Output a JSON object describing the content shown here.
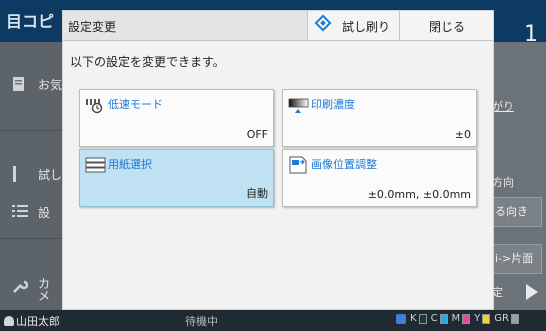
{
  "background": {
    "app_title": "目コピ",
    "counter": "1",
    "left_items": [
      {
        "icon": "document-icon",
        "label": "お気"
      },
      {
        "icon": "thin-bar-icon",
        "label": "試し"
      },
      {
        "icon": "list-icon",
        "label": "設"
      },
      {
        "icon": "wrench-icon",
        "label": "カ\nメ"
      }
    ],
    "right_items": [
      "がり",
      "方向",
      "る向き",
      "i->片面",
      "定"
    ],
    "status": {
      "user": "山田太郎",
      "state": "待機中",
      "inks": [
        "K",
        "C",
        "M",
        "Y",
        "GR"
      ]
    },
    "colors": {
      "ink_c": "#2ea8e0",
      "ink_m": "#e64aa0",
      "ink_y": "#f2d23a",
      "ink_gr": "#9aa0a4"
    }
  },
  "dialog": {
    "title": "設定変更",
    "trial_print_label": "試し刷り",
    "close_label": "閉じる",
    "description": "以下の設定を変更できます。",
    "tiles": [
      {
        "label": "低速モード",
        "value": "OFF",
        "icon": "slow-mode-icon",
        "selected": false
      },
      {
        "label": "印刷濃度",
        "value": "±0",
        "icon": "print-density-icon",
        "selected": false
      },
      {
        "label": "用紙選択",
        "value": "自動",
        "icon": "paper-tray-icon",
        "selected": true
      },
      {
        "label": "画像位置調整",
        "value": "±0.0mm, ±0.0mm",
        "icon": "image-position-icon",
        "selected": false
      }
    ]
  },
  "accent_color": "#1b7bd6",
  "selected_tile_color": "#bfe1f2"
}
